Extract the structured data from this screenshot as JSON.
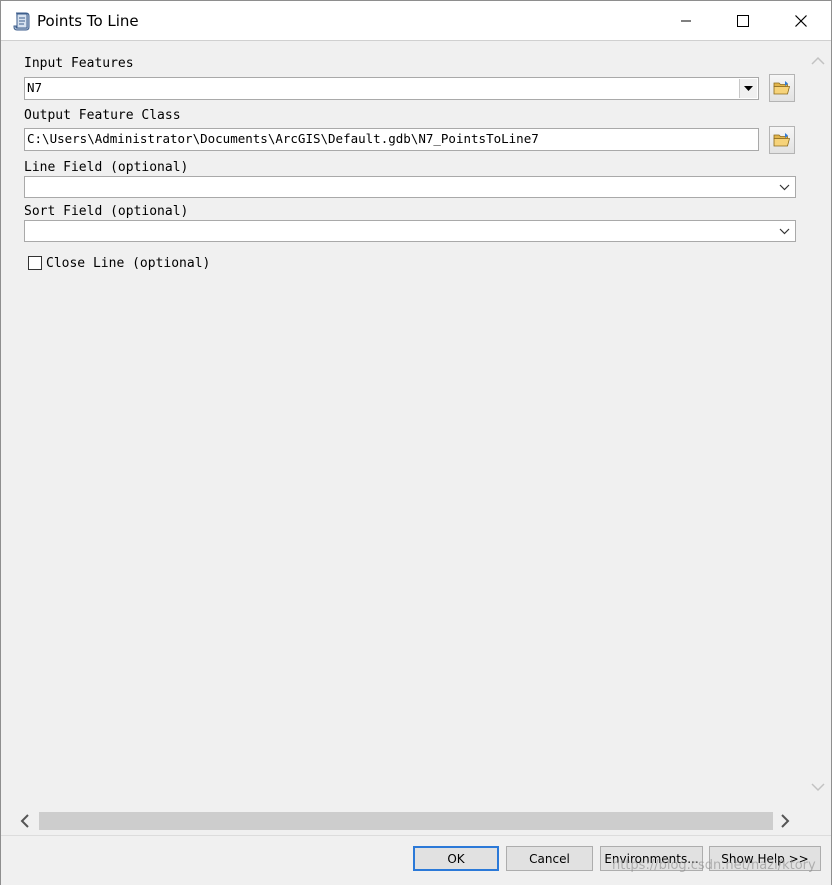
{
  "window": {
    "title": "Points To Line",
    "icon": "toolbox-scroll-icon",
    "controls": [
      "minimize-icon",
      "maximize-icon",
      "close-icon"
    ]
  },
  "form": {
    "input_features": {
      "label": "Input Features",
      "value": "N7",
      "browse_icon": "open-folder-icon"
    },
    "output_feature_class": {
      "label": "Output Feature Class",
      "value": "C:\\Users\\Administrator\\Documents\\ArcGIS\\Default.gdb\\N7_PointsToLine7",
      "browse_icon": "open-folder-icon"
    },
    "line_field": {
      "label": "Line Field (optional)",
      "value": ""
    },
    "sort_field": {
      "label": "Sort Field (optional)",
      "value": ""
    },
    "close_line": {
      "label": "Close Line (optional)",
      "checked": false
    }
  },
  "buttons": {
    "ok": "OK",
    "cancel": "Cancel",
    "environments": "Environments...",
    "show_help": "Show Help >>"
  },
  "watermark": "https://blog.csdn.net/nazi/ktory",
  "colors": {
    "window_bg": "#f0f0f0",
    "titlebar_bg": "#ffffff",
    "default_button_border": "#2b79d8",
    "scroll_track": "#cdcdcd"
  }
}
